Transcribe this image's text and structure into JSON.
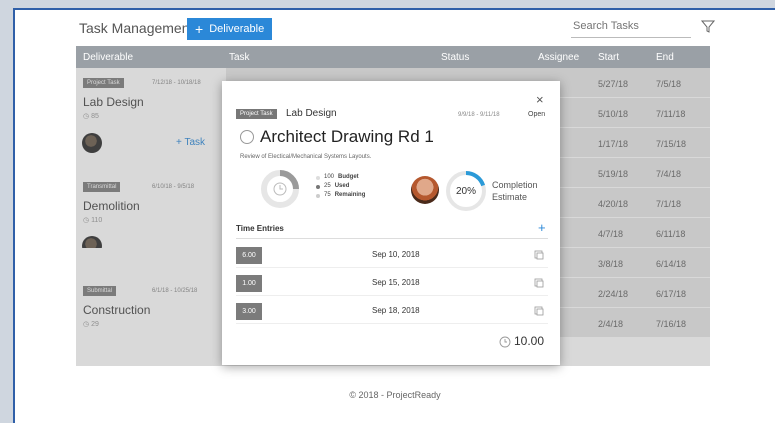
{
  "header": {
    "title": "Task Management",
    "add_label": "Deliverable",
    "search_placeholder": "Search Tasks"
  },
  "table": {
    "columns": [
      "Deliverable",
      "Task",
      "Status",
      "Assignee",
      "Start",
      "End"
    ]
  },
  "deliverables": [
    {
      "tag": "Project Task",
      "dates": "7/12/18 - 10/18/18",
      "name": "Lab Design",
      "count": "85",
      "add_task_label": "Task"
    },
    {
      "tag": "Transmittal",
      "dates": "6/10/18 - 9/5/18",
      "name": "Demolition",
      "count": "110"
    },
    {
      "tag": "Submittal",
      "dates": "6/1/18 - 10/25/18",
      "name": "Construction",
      "count": "29"
    }
  ],
  "task_rows": [
    {
      "start": "5/27/18",
      "end": "7/5/18"
    },
    {
      "start": "5/10/18",
      "end": "7/11/18"
    },
    {
      "start": "1/17/18",
      "end": "7/15/18"
    },
    {
      "start": "5/19/18",
      "end": "7/4/18"
    },
    {
      "start": "4/20/18",
      "end": "7/1/18"
    },
    {
      "start": "4/7/18",
      "end": "6/11/18"
    },
    {
      "start": "3/8/18",
      "end": "6/14/18"
    },
    {
      "start": "2/24/18",
      "end": "6/17/18"
    },
    {
      "start": "2/4/18",
      "end": "7/16/18"
    }
  ],
  "modal": {
    "tag": "Project Task",
    "deliverable": "Lab Design",
    "dates": "9/9/18 - 9/11/18",
    "status": "Open",
    "title": "Architect Drawing Rd 1",
    "description": "Review of Electical/Mechanical Systems Layouts.",
    "budget": {
      "budget_value": "100",
      "budget_label": "Budget",
      "used_value": "25",
      "used_label": "Used",
      "remaining_value": "75",
      "remaining_label": "Remaining"
    },
    "completion_pct": "20%",
    "completion_fraction": 0.2,
    "completion_label_1": "Completion",
    "completion_label_2": "Estimate",
    "time_entries_label": "Time Entries",
    "entries": [
      {
        "hours": "6.00",
        "date": "Sep 10, 2018"
      },
      {
        "hours": "1.00",
        "date": "Sep 15, 2018"
      },
      {
        "hours": "3.00",
        "date": "Sep 18, 2018"
      }
    ],
    "total": "10.00"
  },
  "footer": "© 2018 - ProjectReady",
  "colors": {
    "accent": "#2b88d8",
    "header_bg": "#9aa0a6",
    "frame": "#2f5fa8"
  }
}
